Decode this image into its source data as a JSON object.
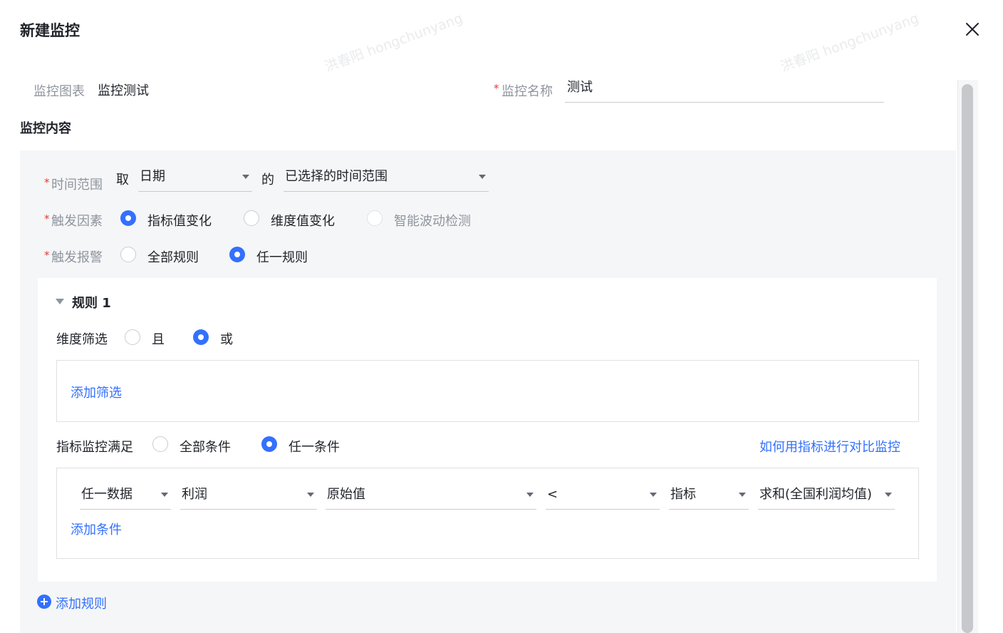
{
  "dialog": {
    "title": "新建监控",
    "close_icon": "close-icon"
  },
  "form": {
    "chart_label": "监控图表",
    "chart_value": "监控测试",
    "name_required_mark": "*",
    "name_label": "监控名称",
    "name_value": "测试"
  },
  "content_section": {
    "title": "监控内容",
    "time_range": {
      "required_mark": "*",
      "label": "时间范围",
      "take_text": "取",
      "field_select": "日期",
      "of_text": "的",
      "range_select": "已选择的时间范围"
    },
    "trigger_factor": {
      "required_mark": "*",
      "label": "触发因素",
      "options": [
        "指标值变化",
        "维度值变化",
        "智能波动检测"
      ],
      "selected_index": 0
    },
    "trigger_alarm": {
      "required_mark": "*",
      "label": "触发报警",
      "options": [
        "全部规则",
        "任一规则"
      ],
      "selected_index": 1
    }
  },
  "rule": {
    "title": "规则 1",
    "dimension_filter_label": "维度筛选",
    "dimension_options": [
      "且",
      "或"
    ],
    "dimension_selected_index": 1,
    "add_filter_link": "添加筛选",
    "metric_condition_label": "指标监控满足",
    "metric_options": [
      "全部条件",
      "任一条件"
    ],
    "metric_selected_index": 1,
    "help_link": "如何用指标进行对比监控",
    "condition_row": {
      "scope": "任一数据",
      "field": "利润",
      "value_type": "原始值",
      "operator": "<",
      "compare_type": "指标",
      "compare_value": "求和(全国利润均值)"
    },
    "add_condition_link": "添加条件"
  },
  "add_rule_link": "添加规则",
  "watermark": "洪春阳 hongchunyang",
  "colors": {
    "accent": "#3370ff",
    "required": "#e53935",
    "panel_bg": "#f5f6f7"
  }
}
